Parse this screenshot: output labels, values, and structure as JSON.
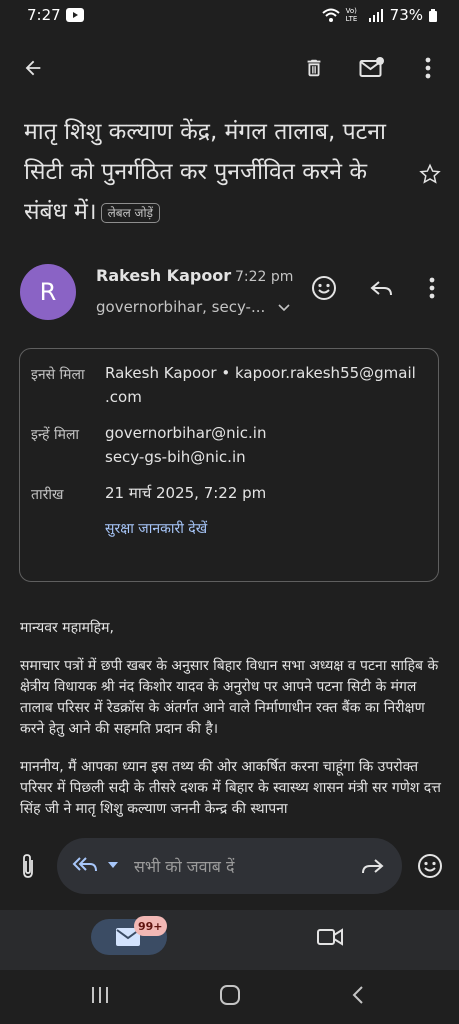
{
  "status_bar": {
    "time": "7:27",
    "network_label": "Vo) LTE",
    "battery": "73%"
  },
  "app_bar": {
    "icons": [
      "back-arrow-icon",
      "delete-icon",
      "mark-unread-icon",
      "more-vert-icon"
    ]
  },
  "email": {
    "subject": "मातृ शिशु कल्याण केंद्र, मंगल तालाब, पटना सिटी को पुनर्गठित कर पुनर्जीवित करने के संबंध में।",
    "add_label": "लेबल जोड़ें",
    "sender": {
      "avatar_letter": "R",
      "avatar_color": "#8a63c5",
      "name": "Rakesh Kapoor",
      "time": "7:22 pm",
      "recipients_short": "governorbihar, secy-..."
    },
    "details": {
      "from_label": "इनसे मिला",
      "from_name": "Rakesh Kapoor",
      "from_email_line1": "kapoor.rakesh55@gmail",
      "from_email_line2": ".com",
      "to_label": "इन्हें मिला",
      "to_1": "governorbihar@nic.in",
      "to_2": "secy-gs-bih@nic.in",
      "date_label": "तारीख",
      "date_value": "21 मार्च 2025, 7:22 pm",
      "security_link": "सुरक्षा जानकारी देखें"
    },
    "body": {
      "salutation": "मान्यवर महामहिम,",
      "p1": "समाचार पत्रों में छपी खबर के अनुसार बिहार विधान सभा अध्यक्ष व पटना साहिब के क्षेत्रीय विधायक श्री नंद किशोर यादव के अनुरोध पर आपने पटना सिटी के मंगल तालाब परिसर में रेडक्रॉस के अंतर्गत आने वाले निर्माणाधीन रक्त बैंक का निरीक्षण करने हेतु आने की सहमति प्रदान की है।",
      "p2": "माननीय, मैं आपका ध्यान इस तथ्य की ओर आकर्षित करना चाहूंगा कि उपरोक्त परिसर में पिछली सदी के तीसरे दशक में बिहार के स्वास्थ्य शासन मंत्री सर गणेश दत्त सिंह जी ने मातृ शिशु कल्याण जननी केन्द्र की स्थापना"
    }
  },
  "reply_bar": {
    "placeholder": "सभी को जवाब दें"
  },
  "bottom_nav": {
    "mail_badge": "99+"
  },
  "colors": {
    "background": "#1f1f1f",
    "accent_link": "#a8c7fa",
    "avatar": "#8a63c5",
    "badge": "#f2b8b5"
  }
}
